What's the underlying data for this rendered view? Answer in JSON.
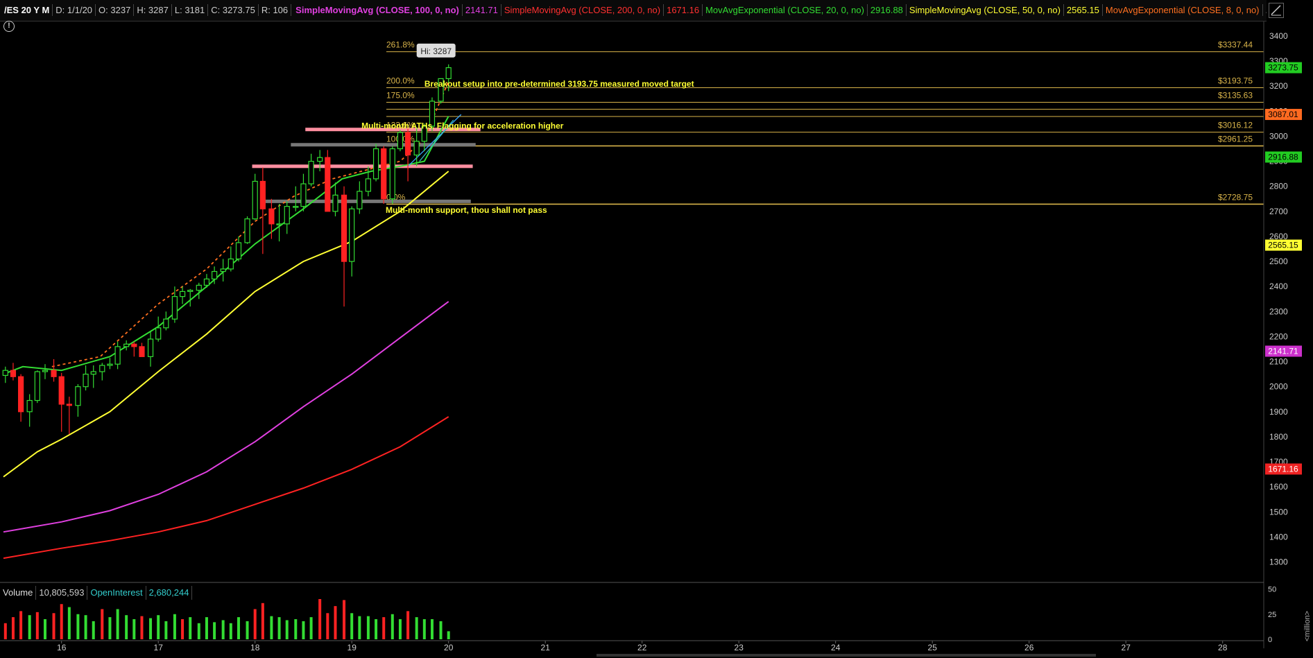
{
  "header": {
    "symbol": "/ES 20 Y M",
    "date": "D: 1/1/20",
    "open": "O: 3237",
    "high": "H: 3287",
    "low": "L: 3181",
    "close": "C: 3273.75",
    "range": "R: 106",
    "studies": [
      {
        "label": "SimpleMovingAvg (CLOSE, 100, 0, no)",
        "value": "2141.71",
        "color": "#e040e0"
      },
      {
        "label": "SimpleMovingAvg (CLOSE, 200, 0, no)",
        "value": "1671.16",
        "color": "#ff3030"
      },
      {
        "label": "MovAvgExponential (CLOSE, 20, 0, no)",
        "value": "2916.88",
        "color": "#33dd33"
      },
      {
        "label": "SimpleMovingAvg (CLOSE, 50, 0, no)",
        "value": "2565.15",
        "color": "#ffff33"
      },
      {
        "label": "MovAvgExponential (CLOSE, 8, 0, no)",
        "value": "",
        "color": "#ff7020"
      }
    ],
    "more": "..."
  },
  "y_axis": {
    "ticks": [
      "3400",
      "3300",
      "3200",
      "3100",
      "3000",
      "2900",
      "2800",
      "2700",
      "2600",
      "2500",
      "2400",
      "2300",
      "2200",
      "2100",
      "2000",
      "1900",
      "1800",
      "1700",
      "1600",
      "1500",
      "1400",
      "1300"
    ],
    "badges": [
      {
        "price": 3273.75,
        "text": "3273.75",
        "bg": "#22cc22",
        "fg": "#000"
      },
      {
        "price": 3087.01,
        "text": "3087.01",
        "bg": "#ff6a20",
        "fg": "#000"
      },
      {
        "price": 2916.88,
        "text": "2916.88",
        "bg": "#22cc22",
        "fg": "#000"
      },
      {
        "price": 2565.15,
        "text": "2565.15",
        "bg": "#ffff33",
        "fg": "#000"
      },
      {
        "price": 2141.71,
        "text": "2141.71",
        "bg": "#cc30cc",
        "fg": "#fff"
      },
      {
        "price": 1671.16,
        "text": "1671.16",
        "bg": "#ee2222",
        "fg": "#fff"
      }
    ]
  },
  "x_axis": {
    "labels": [
      "16",
      "17",
      "18",
      "19",
      "20",
      "21",
      "22",
      "23",
      "24",
      "25",
      "26",
      "27",
      "28"
    ]
  },
  "fib_levels": [
    {
      "pct": "261.8%",
      "price": "$3337.44",
      "value": 3337.44
    },
    {
      "pct": "200.0%",
      "price": "$3193.75",
      "value": 3193.75
    },
    {
      "pct": "175.0%",
      "price": "$3135.63",
      "value": 3135.63
    },
    {
      "pct": "",
      "price": "",
      "value": 3108
    },
    {
      "pct": "",
      "price": "",
      "value": 3079
    },
    {
      "pct": "123.6%",
      "price": "$3016.12",
      "value": 3016.12
    },
    {
      "pct": "100.0%",
      "price": "$2961.25",
      "value": 2961.25
    },
    {
      "pct": "0.0%",
      "price": "$2728.75",
      "value": 2728.75
    }
  ],
  "hi_label": "Hi: 3287",
  "annotations": [
    {
      "text": "Breakout setup  into pre-determined 3193.75 measured moved target",
      "price": 3198,
      "x_month": 19.75
    },
    {
      "text": "Multi-month ATHs. Flagging for acceleration higher",
      "price": 3030,
      "x_month": 19.1
    },
    {
      "text": "Multi-month support, thou shall not pass",
      "price": 2694,
      "x_month": 19.35
    }
  ],
  "zones": [
    {
      "from": 18.52,
      "to": 20.33,
      "price": 3027,
      "color": "#ff8fa0"
    },
    {
      "from": 18.37,
      "to": 20.28,
      "price": 2966,
      "color": "#777777"
    },
    {
      "from": 17.97,
      "to": 20.25,
      "price": 2880,
      "color": "#ff8fa0"
    },
    {
      "from": 18.08,
      "to": 20.23,
      "price": 2740,
      "color": "#777777"
    }
  ],
  "volume": {
    "label": "Volume",
    "value": "10,805,593",
    "oi_label": "OpenInterest",
    "oi_value": "2,680,244",
    "ticks": [
      "50",
      "25",
      "0"
    ],
    "unit": "<million>"
  },
  "colors": {
    "up": "#33dd33",
    "down": "#ff2222",
    "fib": "#d9b44a",
    "background": "#000000"
  },
  "chart_data": {
    "type": "candlestick",
    "symbol": "/ES 20 Y M",
    "interval": "monthly",
    "x_range": [
      15.4,
      28.4
    ],
    "y_range": [
      1200,
      3450
    ],
    "candles": [
      [
        15.42,
        2045,
        2080,
        2015,
        2065
      ],
      [
        15.5,
        2065,
        2095,
        2025,
        2040
      ],
      [
        15.58,
        2040,
        2050,
        1860,
        1900
      ],
      [
        15.67,
        1900,
        1970,
        1840,
        1945
      ],
      [
        15.75,
        1945,
        2065,
        1935,
        2060
      ],
      [
        15.83,
        2060,
        2090,
        2030,
        2065
      ],
      [
        15.92,
        2065,
        2110,
        2020,
        2040
      ],
      [
        16.0,
        2040,
        2055,
        1820,
        1930
      ],
      [
        16.08,
        1930,
        1960,
        1810,
        1925
      ],
      [
        16.17,
        1925,
        2010,
        1880,
        2000
      ],
      [
        16.25,
        2000,
        2085,
        1985,
        2050
      ],
      [
        16.33,
        2050,
        2085,
        1995,
        2060
      ],
      [
        16.42,
        2060,
        2095,
        2025,
        2085
      ],
      [
        16.5,
        2085,
        2115,
        2070,
        2090
      ],
      [
        16.58,
        2090,
        2180,
        2070,
        2160
      ],
      [
        16.67,
        2160,
        2185,
        2145,
        2170
      ],
      [
        16.75,
        2170,
        2180,
        2120,
        2160
      ],
      [
        16.83,
        2160,
        2175,
        2120,
        2120
      ],
      [
        16.92,
        2120,
        2220,
        2080,
        2190
      ],
      [
        17.0,
        2190,
        2280,
        2180,
        2235
      ],
      [
        17.08,
        2235,
        2300,
        2225,
        2270
      ],
      [
        17.17,
        2270,
        2400,
        2255,
        2360
      ],
      [
        17.25,
        2360,
        2400,
        2330,
        2380
      ],
      [
        17.33,
        2380,
        2390,
        2320,
        2385
      ],
      [
        17.42,
        2385,
        2415,
        2350,
        2405
      ],
      [
        17.5,
        2405,
        2450,
        2395,
        2430
      ],
      [
        17.58,
        2430,
        2480,
        2410,
        2460
      ],
      [
        17.67,
        2460,
        2510,
        2420,
        2470
      ],
      [
        17.75,
        2470,
        2560,
        2460,
        2510
      ],
      [
        17.83,
        2510,
        2600,
        2500,
        2575
      ],
      [
        17.92,
        2575,
        2680,
        2570,
        2670
      ],
      [
        18.0,
        2670,
        2850,
        2665,
        2820
      ],
      [
        18.08,
        2820,
        2875,
        2530,
        2710
      ],
      [
        18.17,
        2710,
        2750,
        2590,
        2650
      ],
      [
        18.25,
        2650,
        2730,
        2580,
        2650
      ],
      [
        18.33,
        2650,
        2740,
        2610,
        2720
      ],
      [
        18.42,
        2720,
        2800,
        2700,
        2720
      ],
      [
        18.5,
        2720,
        2850,
        2700,
        2810
      ],
      [
        18.58,
        2810,
        2930,
        2800,
        2900
      ],
      [
        18.67,
        2900,
        2945,
        2860,
        2915
      ],
      [
        18.75,
        2915,
        2945,
        2805,
        2700
      ],
      [
        18.83,
        2700,
        2815,
        2680,
        2765
      ],
      [
        18.92,
        2765,
        2800,
        2320,
        2500
      ],
      [
        19.0,
        2500,
        2720,
        2440,
        2710
      ],
      [
        19.08,
        2710,
        2820,
        2690,
        2780
      ],
      [
        19.17,
        2780,
        2880,
        2760,
        2830
      ],
      [
        19.25,
        2830,
        2970,
        2820,
        2950
      ],
      [
        19.33,
        2950,
        2960,
        2730,
        2750
      ],
      [
        19.42,
        2750,
        2960,
        2730,
        2950
      ],
      [
        19.5,
        2950,
        3025,
        2940,
        3015
      ],
      [
        19.58,
        3015,
        3030,
        2820,
        2925
      ],
      [
        19.67,
        2925,
        3035,
        2880,
        2980
      ],
      [
        19.75,
        2980,
        3050,
        2940,
        3040
      ],
      [
        19.83,
        3040,
        3155,
        3020,
        3140
      ],
      [
        19.92,
        3140,
        3230,
        3130,
        3230
      ],
      [
        20.0,
        3230,
        3287,
        3180,
        3273.75
      ]
    ],
    "moving_averages": [
      {
        "name": "SimpleMovingAvg (CLOSE, 200, 0, no)",
        "color": "#ff2222",
        "points": [
          [
            15.4,
            1315
          ],
          [
            16.0,
            1355
          ],
          [
            16.5,
            1385
          ],
          [
            17.0,
            1420
          ],
          [
            17.5,
            1465
          ],
          [
            18.0,
            1530
          ],
          [
            18.5,
            1595
          ],
          [
            19.0,
            1670
          ],
          [
            19.5,
            1760
          ],
          [
            20.0,
            1880
          ]
        ]
      },
      {
        "name": "SimpleMovingAvg (CLOSE, 100, 0, no)",
        "color": "#e040e0",
        "points": [
          [
            15.4,
            1420
          ],
          [
            16.0,
            1460
          ],
          [
            16.5,
            1505
          ],
          [
            17.0,
            1570
          ],
          [
            17.5,
            1660
          ],
          [
            18.0,
            1780
          ],
          [
            18.5,
            1920
          ],
          [
            19.0,
            2050
          ],
          [
            19.5,
            2195
          ],
          [
            20.0,
            2340
          ]
        ]
      },
      {
        "name": "SimpleMovingAvg (CLOSE, 50, 0, no)",
        "color": "#ffff33",
        "points": [
          [
            15.4,
            1640
          ],
          [
            15.75,
            1740
          ],
          [
            16.0,
            1790
          ],
          [
            16.5,
            1900
          ],
          [
            17.0,
            2060
          ],
          [
            17.5,
            2210
          ],
          [
            18.0,
            2380
          ],
          [
            18.5,
            2500
          ],
          [
            19.0,
            2580
          ],
          [
            19.5,
            2700
          ],
          [
            20.0,
            2860
          ]
        ]
      },
      {
        "name": "MovAvgExponential (CLOSE, 20, 0, no)",
        "color": "#33dd33",
        "points": [
          [
            15.4,
            2050
          ],
          [
            15.6,
            2080
          ],
          [
            16.0,
            2065
          ],
          [
            16.5,
            2120
          ],
          [
            17.0,
            2240
          ],
          [
            17.5,
            2400
          ],
          [
            18.0,
            2570
          ],
          [
            18.5,
            2710
          ],
          [
            18.9,
            2830
          ],
          [
            19.2,
            2860
          ],
          [
            19.5,
            2880
          ],
          [
            19.75,
            2900
          ],
          [
            20.0,
            3080
          ]
        ]
      },
      {
        "name": "MovAvgExponential (CLOSE, 8, 0, no)",
        "color": "#ff7020",
        "dashed": true,
        "points": [
          [
            15.9,
            2080
          ],
          [
            16.4,
            2120
          ],
          [
            17.0,
            2330
          ],
          [
            17.5,
            2470
          ],
          [
            18.0,
            2660
          ],
          [
            18.4,
            2760
          ],
          [
            18.8,
            2830
          ],
          [
            19.2,
            2870
          ],
          [
            19.5,
            2900
          ],
          [
            19.75,
            2990
          ],
          [
            20.0,
            3220
          ]
        ]
      }
    ],
    "trendlines": [
      {
        "color": "#3aa6ff",
        "points": [
          [
            19.58,
            2880
          ],
          [
            20.13,
            3087
          ]
        ]
      },
      {
        "color": "#33c3c3",
        "points": [
          [
            19.7,
            2900
          ],
          [
            20.05,
            3065
          ]
        ]
      }
    ],
    "volume_millions": [
      [
        15.42,
        16,
        "down"
      ],
      [
        15.5,
        22,
        "down"
      ],
      [
        15.58,
        28,
        "down"
      ],
      [
        15.67,
        24,
        "up"
      ],
      [
        15.75,
        27,
        "down"
      ],
      [
        15.83,
        20,
        "up"
      ],
      [
        15.92,
        26,
        "down"
      ],
      [
        16.0,
        35,
        "down"
      ],
      [
        16.08,
        32,
        "up"
      ],
      [
        16.17,
        25,
        "up"
      ],
      [
        16.25,
        24,
        "up"
      ],
      [
        16.33,
        18,
        "up"
      ],
      [
        16.42,
        30,
        "down"
      ],
      [
        16.5,
        22,
        "up"
      ],
      [
        16.58,
        30,
        "up"
      ],
      [
        16.67,
        24,
        "up"
      ],
      [
        16.75,
        20,
        "up"
      ],
      [
        16.83,
        23,
        "down"
      ],
      [
        16.92,
        21,
        "up"
      ],
      [
        17.0,
        24,
        "up"
      ],
      [
        17.08,
        18,
        "up"
      ],
      [
        17.17,
        25,
        "up"
      ],
      [
        17.25,
        20,
        "down"
      ],
      [
        17.33,
        22,
        "up"
      ],
      [
        17.42,
        16,
        "up"
      ],
      [
        17.5,
        22,
        "up"
      ],
      [
        17.58,
        17,
        "up"
      ],
      [
        17.67,
        19,
        "up"
      ],
      [
        17.75,
        16,
        "up"
      ],
      [
        17.83,
        22,
        "up"
      ],
      [
        17.92,
        18,
        "up"
      ],
      [
        18.0,
        30,
        "down"
      ],
      [
        18.08,
        36,
        "down"
      ],
      [
        18.17,
        23,
        "up"
      ],
      [
        18.25,
        22,
        "up"
      ],
      [
        18.33,
        19,
        "up"
      ],
      [
        18.42,
        20,
        "up"
      ],
      [
        18.5,
        18,
        "up"
      ],
      [
        18.58,
        22,
        "up"
      ],
      [
        18.67,
        40,
        "down"
      ],
      [
        18.75,
        26,
        "down"
      ],
      [
        18.83,
        33,
        "down"
      ],
      [
        18.92,
        39,
        "down"
      ],
      [
        19.0,
        26,
        "up"
      ],
      [
        19.08,
        23,
        "up"
      ],
      [
        19.17,
        23,
        "up"
      ],
      [
        19.25,
        20,
        "up"
      ],
      [
        19.33,
        22,
        "down"
      ],
      [
        19.42,
        25,
        "up"
      ],
      [
        19.5,
        20,
        "up"
      ],
      [
        19.58,
        28,
        "down"
      ],
      [
        19.67,
        22,
        "up"
      ],
      [
        19.75,
        20,
        "up"
      ],
      [
        19.83,
        20,
        "up"
      ],
      [
        19.92,
        18,
        "up"
      ],
      [
        20.0,
        8,
        "up"
      ]
    ]
  }
}
